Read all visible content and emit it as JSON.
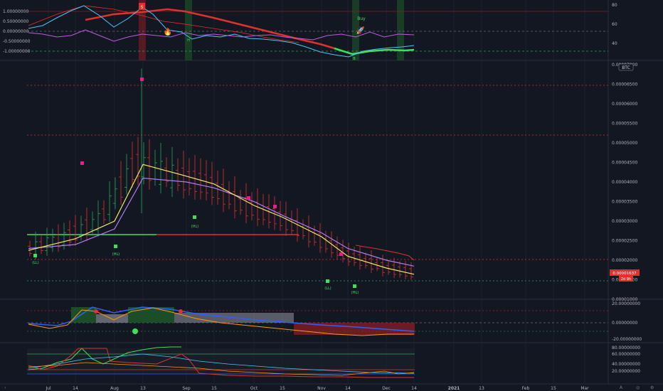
{
  "symbol_badge": "BTC",
  "time_axis": {
    "labels": [
      "Jul",
      "14",
      "Aug",
      "13",
      "Sep",
      "15",
      "Oct",
      "15",
      "Nov",
      "14",
      "Dec",
      "14",
      "2021",
      "13",
      "Feb",
      "15",
      "Mar"
    ]
  },
  "panes": {
    "oscillator": {
      "left_ticks": [
        "1.00000000",
        "0.50000000",
        "0.00000000",
        "-0.50000000",
        "-1.00000000"
      ],
      "right_ticks": [
        "80",
        "60",
        "40"
      ],
      "markers": {
        "sell": "S",
        "buy_label": "Buy",
        "h": "H",
        "b": "B"
      }
    },
    "price": {
      "right_ticks": [
        "0.00007000",
        "0.00006500",
        "0.00006000",
        "0.00005500",
        "0.00005000",
        "0.00004500",
        "0.00004000",
        "0.00003500",
        "0.00003000",
        "0.00002500",
        "0.00002000",
        "0.00001500",
        "0.00001000"
      ],
      "current_price": "0.00001637",
      "countdown": "2d 9h",
      "pivot_labels": [
        "(LL)",
        "(HL)",
        "(HL)",
        "(LL)",
        "(HL)"
      ]
    },
    "momentum": {
      "right_ticks": [
        "20.00000000",
        "0.00000000",
        "-20.00000000"
      ]
    },
    "rsi": {
      "right_ticks": [
        "80.00000000",
        "60.00000000",
        "40.00000000",
        "20.00000000"
      ]
    }
  },
  "colors": {
    "background": "#131722",
    "grid": "#1e222d",
    "up": "#26a65b",
    "down": "#e0312e",
    "ma_fast": "#f5e56b",
    "ma_slow": "#b07cf0",
    "marker": "#e91e8c",
    "price_tag": "#e0312e"
  },
  "chart_data": {
    "type": "line",
    "x": [
      "Jul 1",
      "Jul 14",
      "Aug 1",
      "Aug 13",
      "Sep 1",
      "Sep 15",
      "Oct 1",
      "Oct 15",
      "Nov 1",
      "Nov 14",
      "Dec 1",
      "Dec 14"
    ],
    "series": [
      {
        "values": [
          2.25e-05,
          2.55e-05,
          3e-05,
          4.45e-05,
          4.15e-05,
          3.95e-05,
          3.4e-05,
          3.1e-05,
          2.6e-05,
          2.1e-05,
          1.8e-05,
          1.64e-05
        ]
      },
      {
        "values": [
          2.3e-05,
          2.4e-05,
          2.8e-05,
          4.1e-05,
          4e-05,
          3.85e-05,
          3.5e-05,
          3.15e-05,
          2.7e-05,
          2.3e-05,
          2e-05,
          1.85e-05
        ]
      }
    ],
    "ylim": [
      1e-05,
      7e-05
    ]
  }
}
